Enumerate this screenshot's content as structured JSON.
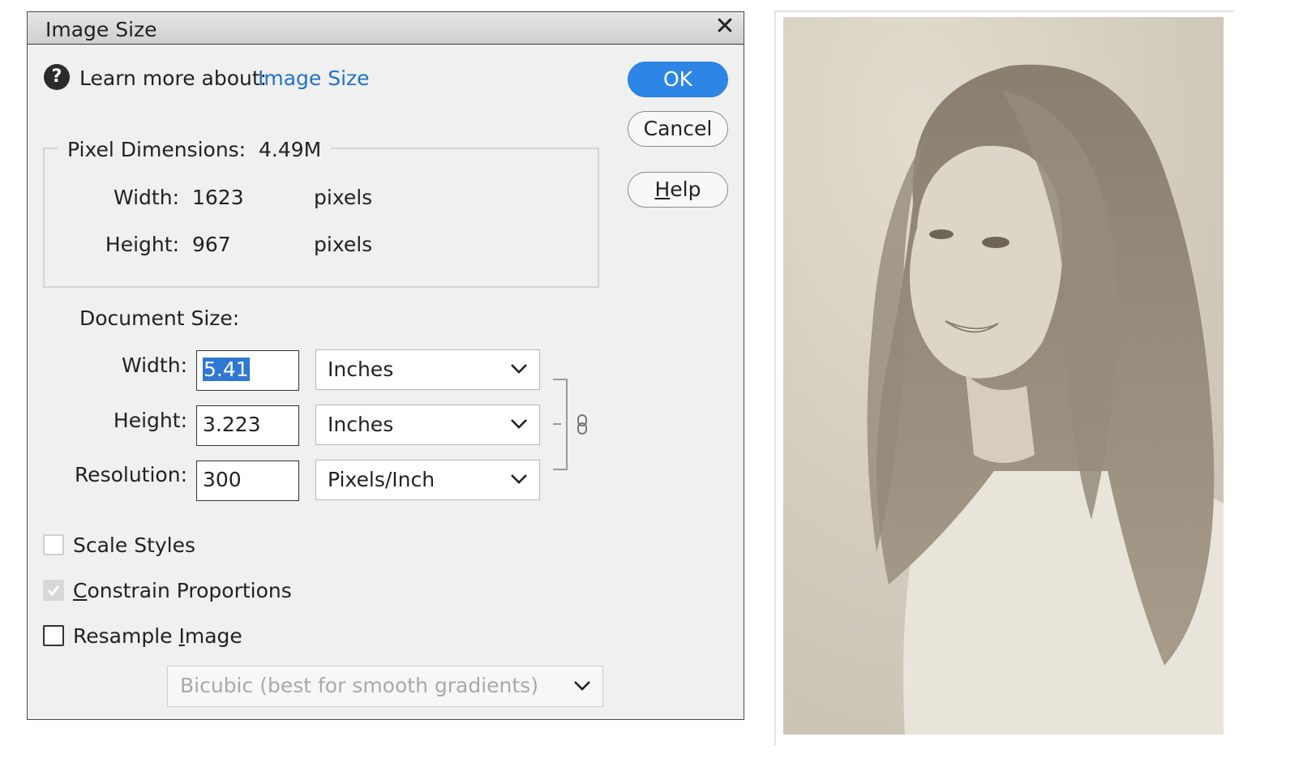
{
  "dialog": {
    "title": "Image Size",
    "learn_more_label": "Learn more about:",
    "learn_more_link": "Image Size",
    "buttons": {
      "ok": "OK",
      "cancel": "Cancel",
      "help_prefix": "H",
      "help_rest": "elp"
    },
    "pixel_dimensions": {
      "legend_label": "Pixel Dimensions:",
      "legend_value": "4.49M",
      "width_label": "Width:",
      "width_value": "1623",
      "width_unit": "pixels",
      "height_label": "Height:",
      "height_value": "967",
      "height_unit": "pixels"
    },
    "document_size": {
      "heading": "Document Size:",
      "width_label": "Width:",
      "width_value": "5.41",
      "width_unit": "Inches",
      "height_label": "Height:",
      "height_value": "3.223",
      "height_unit": "Inches",
      "resolution_label": "Resolution:",
      "resolution_value": "300",
      "resolution_unit": "Pixels/Inch"
    },
    "options": {
      "scale_styles": "Scale Styles",
      "constrain_prefix": "C",
      "constrain_rest": "onstrain Proportions",
      "resample_prefix": "Resample ",
      "resample_ul": "I",
      "resample_rest": "mage",
      "scale_styles_checked": false,
      "constrain_checked": true,
      "resample_checked": false
    },
    "resample_method": "Bicubic (best for smooth gradients)"
  },
  "colors": {
    "ok_button": "#2d86e6",
    "link": "#1f73cf",
    "selection": "#2f78d1"
  }
}
